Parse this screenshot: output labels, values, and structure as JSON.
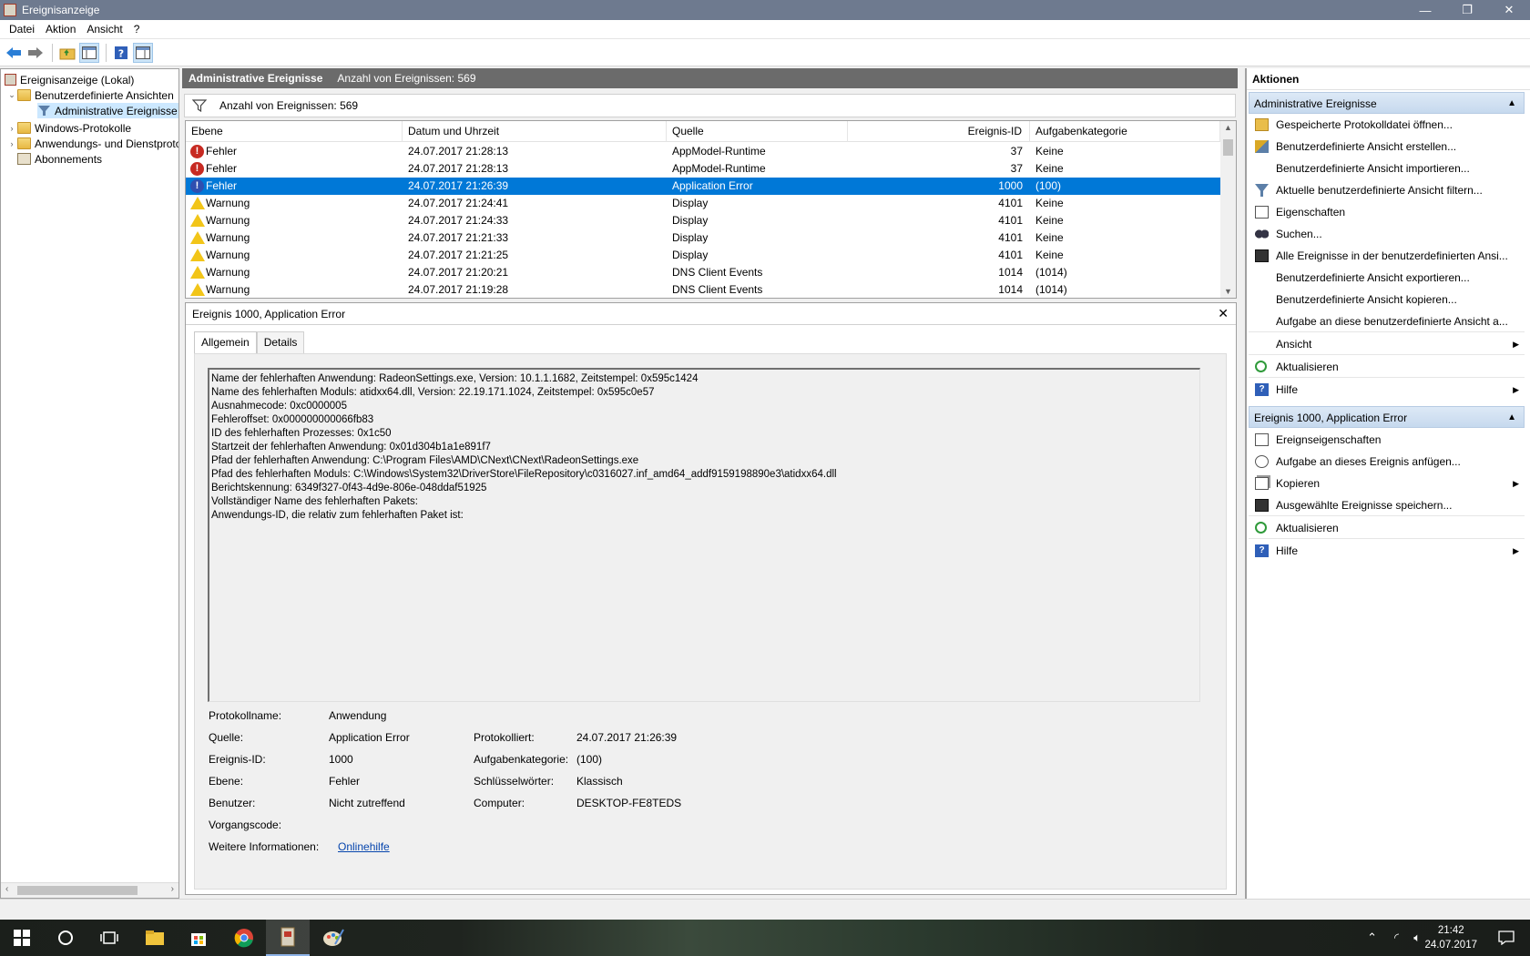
{
  "window": {
    "title": "Ereignisanzeige",
    "minimize": "—",
    "restore": "❐",
    "close": "✕"
  },
  "menu": [
    "Datei",
    "Aktion",
    "Ansicht",
    "?"
  ],
  "tree": {
    "root": "Ereignisanzeige (Lokal)",
    "custom_views": "Benutzerdefinierte Ansichten",
    "admin_events": "Administrative Ereignisse",
    "windows_logs": "Windows-Protokolle",
    "app_service_logs": "Anwendungs- und Dienstprotokolle",
    "subscriptions": "Abonnements"
  },
  "center": {
    "title": "Administrative Ereignisse",
    "count_label": "Anzahl von Ereignissen: 569",
    "filter_text": "Anzahl von Ereignissen: 569"
  },
  "list": {
    "columns": [
      "Ebene",
      "Datum und Uhrzeit",
      "Quelle",
      "Ereignis-ID",
      "Aufgabenkategorie"
    ],
    "rows": [
      {
        "level": "Fehler",
        "kind": "error",
        "datetime": "24.07.2017 21:28:13",
        "source": "AppModel-Runtime",
        "id": "37",
        "category": "Keine"
      },
      {
        "level": "Fehler",
        "kind": "error",
        "datetime": "24.07.2017 21:28:13",
        "source": "AppModel-Runtime",
        "id": "37",
        "category": "Keine"
      },
      {
        "level": "Fehler",
        "kind": "error",
        "datetime": "24.07.2017 21:26:39",
        "source": "Application Error",
        "id": "1000",
        "category": "(100)",
        "selected": true
      },
      {
        "level": "Warnung",
        "kind": "warning",
        "datetime": "24.07.2017 21:24:41",
        "source": "Display",
        "id": "4101",
        "category": "Keine"
      },
      {
        "level": "Warnung",
        "kind": "warning",
        "datetime": "24.07.2017 21:24:33",
        "source": "Display",
        "id": "4101",
        "category": "Keine"
      },
      {
        "level": "Warnung",
        "kind": "warning",
        "datetime": "24.07.2017 21:21:33",
        "source": "Display",
        "id": "4101",
        "category": "Keine"
      },
      {
        "level": "Warnung",
        "kind": "warning",
        "datetime": "24.07.2017 21:21:25",
        "source": "Display",
        "id": "4101",
        "category": "Keine"
      },
      {
        "level": "Warnung",
        "kind": "warning",
        "datetime": "24.07.2017 21:20:21",
        "source": "DNS Client Events",
        "id": "1014",
        "category": "(1014)"
      },
      {
        "level": "Warnung",
        "kind": "warning",
        "datetime": "24.07.2017 21:19:28",
        "source": "DNS Client Events",
        "id": "1014",
        "category": "(1014)"
      }
    ]
  },
  "detail": {
    "title": "Ereignis 1000, Application Error",
    "close": "✕",
    "tabs": [
      "Allgemein",
      "Details"
    ],
    "description": [
      "Name der fehlerhaften Anwendung: RadeonSettings.exe, Version: 10.1.1.1682, Zeitstempel: 0x595c1424",
      "Name des fehlerhaften Moduls: atidxx64.dll, Version: 22.19.171.1024, Zeitstempel: 0x595c0e57",
      "Ausnahmecode: 0xc0000005",
      "Fehleroffset: 0x000000000066fb83",
      "ID des fehlerhaften Prozesses: 0x1c50",
      "Startzeit der fehlerhaften Anwendung: 0x01d304b1a1e891f7",
      "Pfad der fehlerhaften Anwendung: C:\\Program Files\\AMD\\CNext\\CNext\\RadeonSettings.exe",
      "Pfad des fehlerhaften Moduls: C:\\Windows\\System32\\DriverStore\\FileRepository\\c0316027.inf_amd64_addf9159198890e3\\atidxx64.dll",
      "Berichtskennung: 6349f327-0f43-4d9e-806e-048ddaf51925",
      "Vollständiger Name des fehlerhaften Pakets:",
      "Anwendungs-ID, die relativ zum fehlerhaften Paket ist:"
    ],
    "props": {
      "log_label": "Protokollname:",
      "log_value": "Anwendung",
      "source_label": "Quelle:",
      "source_value": "Application Error",
      "logged_label": "Protokolliert:",
      "logged_value": "24.07.2017 21:26:39",
      "id_label": "Ereignis-ID:",
      "id_value": "1000",
      "task_label": "Aufgabenkategorie:",
      "task_value": "(100)",
      "level_label": "Ebene:",
      "level_value": "Fehler",
      "keywords_label": "Schlüsselwörter:",
      "keywords_value": "Klassisch",
      "user_label": "Benutzer:",
      "user_value": "Nicht zutreffend",
      "computer_label": "Computer:",
      "computer_value": "DESKTOP-FE8TEDS",
      "opcode_label": "Vorgangscode:",
      "more_label": "Weitere Informationen:",
      "more_link": "Onlinehilfe"
    }
  },
  "actions": {
    "title": "Aktionen",
    "section1": "Administrative Ereignisse",
    "items1": [
      "Gespeicherte Protokolldatei öffnen...",
      "Benutzerdefinierte Ansicht erstellen...",
      "Benutzerdefinierte Ansicht importieren...",
      "Aktuelle benutzerdefinierte Ansicht filtern...",
      "Eigenschaften",
      "Suchen...",
      "Alle Ereignisse in der benutzerdefinierten Ansi...",
      "Benutzerdefinierte Ansicht exportieren...",
      "Benutzerdefinierte Ansicht kopieren...",
      "Aufgabe an diese benutzerdefinierte Ansicht a...",
      "Ansicht",
      "Aktualisieren",
      "Hilfe"
    ],
    "section2": "Ereignis 1000, Application Error",
    "items2": [
      "Ereignseigenschaften",
      "Aufgabe an dieses Ereignis anfügen...",
      "Kopieren",
      "Ausgewählte Ereignisse speichern...",
      "Aktualisieren",
      "Hilfe"
    ]
  },
  "taskbar": {
    "time": "21:42",
    "date": "24.07.2017"
  },
  "colors": {
    "selection": "#0078d7",
    "header": "#6b6b6b",
    "titlebar": "#6e7a8f",
    "error": "#c72a22",
    "warning": "#f2c518"
  }
}
